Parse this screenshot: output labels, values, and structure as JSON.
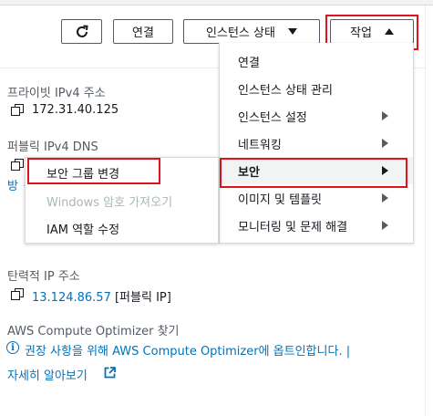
{
  "toolbar": {
    "connect_label": "연결",
    "instance_state_label": "인스턴스 상태",
    "actions_label": "작업"
  },
  "details": {
    "private_ipv4_label": "프라이빗 IPv4 주소",
    "private_ipv4_value": "172.31.40.125",
    "public_ipv4_dns_label": "퍼블릭 IPv4 DNS",
    "public_dns_partial": "방 ㅋ",
    "elastic_ip_label": "탄력적 IP 주소",
    "elastic_ip_value": "13.124.86.57",
    "elastic_ip_suffix": "[퍼블릭 IP]",
    "optimizer_label": "AWS Compute Optimizer 찾기",
    "optimizer_text": "권장 사항을 위해 AWS Compute Optimizer에 옵트인합니다. |",
    "learn_more": "자세히 알아보기"
  },
  "actions_menu": {
    "items": [
      {
        "label": "연결",
        "has_submenu": false
      },
      {
        "label": "인스턴스 상태 관리",
        "has_submenu": false
      },
      {
        "label": "인스턴스 설정",
        "has_submenu": true
      },
      {
        "label": "네트워킹",
        "has_submenu": true
      },
      {
        "label": "보안",
        "has_submenu": true,
        "active": true
      },
      {
        "label": "이미지 및 템플릿",
        "has_submenu": true
      },
      {
        "label": "모니터링 및 문제 해결",
        "has_submenu": true
      }
    ]
  },
  "security_submenu": {
    "items": [
      {
        "label": "보안 그룹 변경",
        "disabled": false
      },
      {
        "label": "Windows 암호 가져오기",
        "disabled": true
      },
      {
        "label": "IAM 역할 수정",
        "disabled": false
      }
    ]
  },
  "colors": {
    "link": "#0073bb",
    "highlight": "#e0121b",
    "disabled": "#aab7b8"
  }
}
